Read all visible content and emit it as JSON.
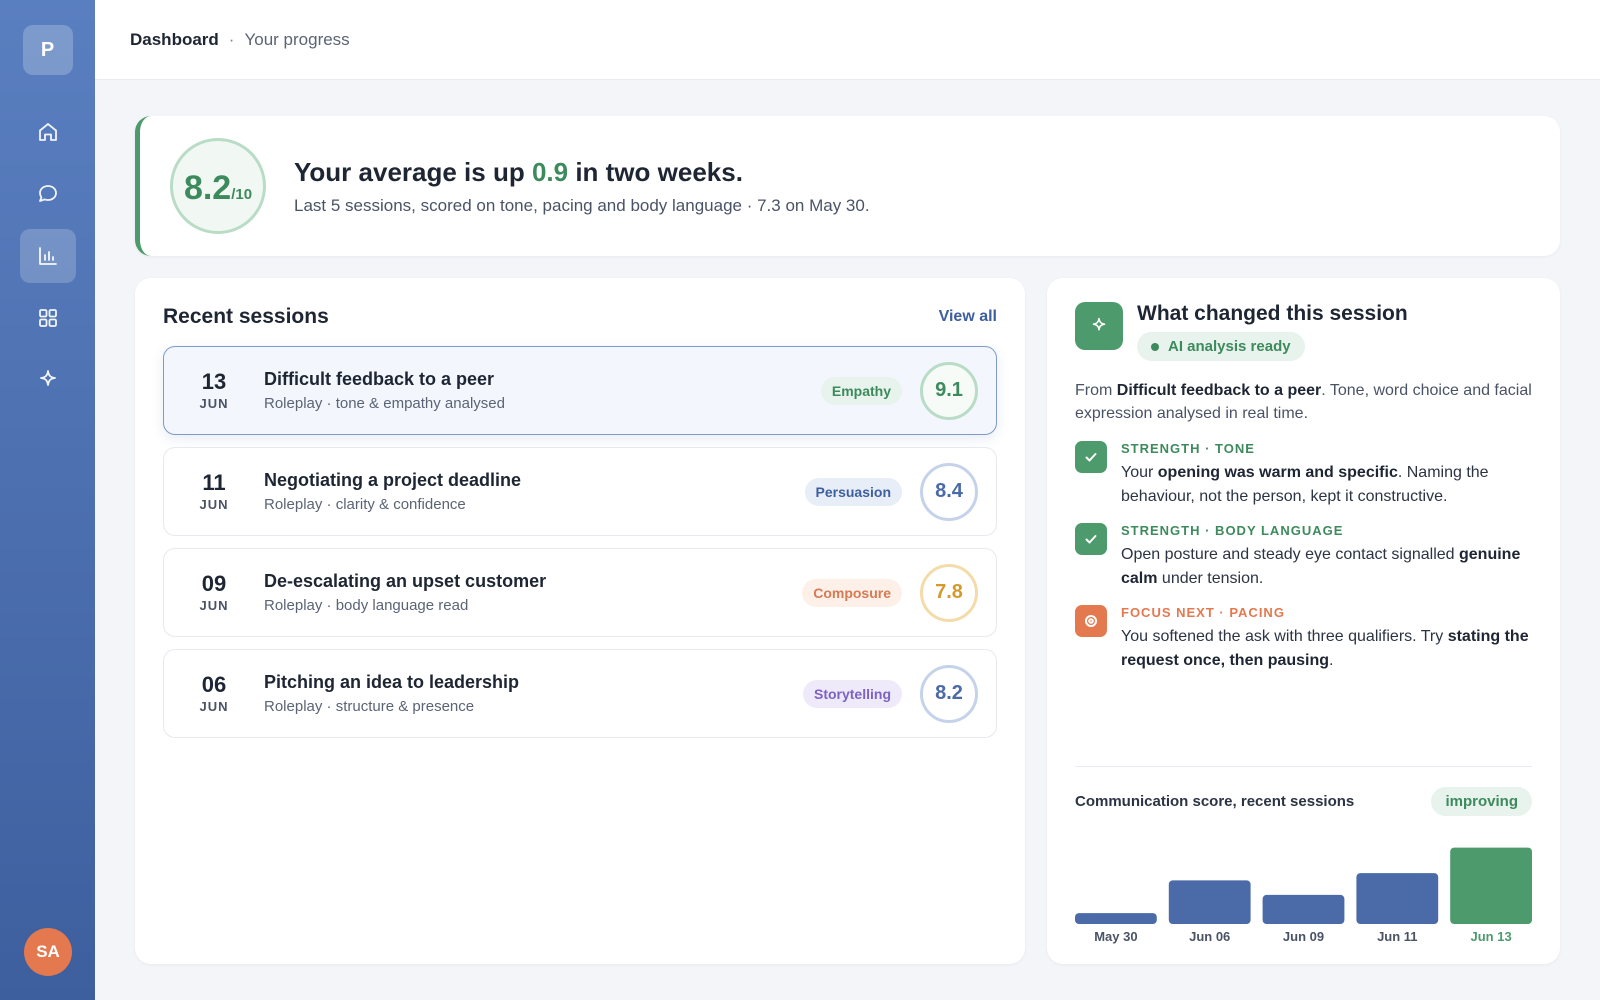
{
  "sidebar": {
    "logo": "P",
    "nav": [
      {
        "name": "home",
        "icon": "home-icon"
      },
      {
        "name": "chat",
        "icon": "chat-icon"
      },
      {
        "name": "progress",
        "icon": "bar-chart-icon",
        "active": true
      },
      {
        "name": "apps",
        "icon": "grid-icon"
      },
      {
        "name": "spark",
        "icon": "sparkle-icon"
      }
    ],
    "avatar": "SA"
  },
  "header": {
    "breadcrumb_main": "Dashboard",
    "breadcrumb_sep": "·",
    "breadcrumb_sub": "Your progress"
  },
  "summary": {
    "score": "8.2",
    "score_denominator": "/10",
    "title_pre": "Your average is up ",
    "title_delta": "0.9",
    "title_post": " in two weeks.",
    "subtitle": "Last 5 sessions, scored on tone, pacing and body language · 7.3 on May 30."
  },
  "sessions": {
    "title": "Recent sessions",
    "view_all": "View all",
    "items": [
      {
        "day": "13",
        "month": "JUN",
        "title": "Difficult feedback to a peer",
        "sub": "Roleplay · tone & empathy analysed",
        "tag": "Empathy",
        "score": "9.1"
      },
      {
        "day": "11",
        "month": "JUN",
        "title": "Negotiating a project deadline",
        "sub": "Roleplay · clarity & confidence",
        "tag": "Persuasion",
        "score": "8.4"
      },
      {
        "day": "09",
        "month": "JUN",
        "title": "De-escalating an upset customer",
        "sub": "Roleplay · body language read",
        "tag": "Composure",
        "score": "7.8"
      },
      {
        "day": "06",
        "month": "JUN",
        "title": "Pitching an idea to leadership",
        "sub": "Roleplay · structure & presence",
        "tag": "Storytelling",
        "score": "8.2"
      }
    ]
  },
  "insights": {
    "title": "What changed this session",
    "status": "AI analysis ready",
    "from_pre": "From ",
    "from_bold": "Difficult feedback to a peer",
    "from_post": ". Tone, word choice and facial expression analysed in real time.",
    "findings": [
      {
        "label": "STRENGTH · TONE",
        "t1": "Your ",
        "b1": "opening was warm and specific",
        "t2": ". Naming the behaviour, not the person, kept it constructive.",
        "b2": "",
        "t3": ""
      },
      {
        "label": "STRENGTH · BODY LANGUAGE",
        "t1": "Open posture and steady eye contact signalled ",
        "b1": "genuine calm",
        "t2": " under tension.",
        "b2": "",
        "t3": ""
      },
      {
        "label": "FOCUS NEXT · PACING",
        "t1": "You softened the ask with three qualifiers. Try ",
        "b1": "stating the request once, then pausing",
        "t2": ".",
        "b2": "",
        "t3": ""
      }
    ],
    "chart_title": "Communication score, recent sessions",
    "chart_badge": "improving"
  },
  "chart_data": {
    "type": "bar",
    "categories": [
      "May 30",
      "Jun 06",
      "Jun 09",
      "Jun 11",
      "Jun 13"
    ],
    "values": [
      7.3,
      8.2,
      7.8,
      8.4,
      9.1
    ],
    "colors": {
      "default": "#4a6aa8",
      "highlight": "#4d9a6c"
    },
    "highlight_index": 4
  }
}
